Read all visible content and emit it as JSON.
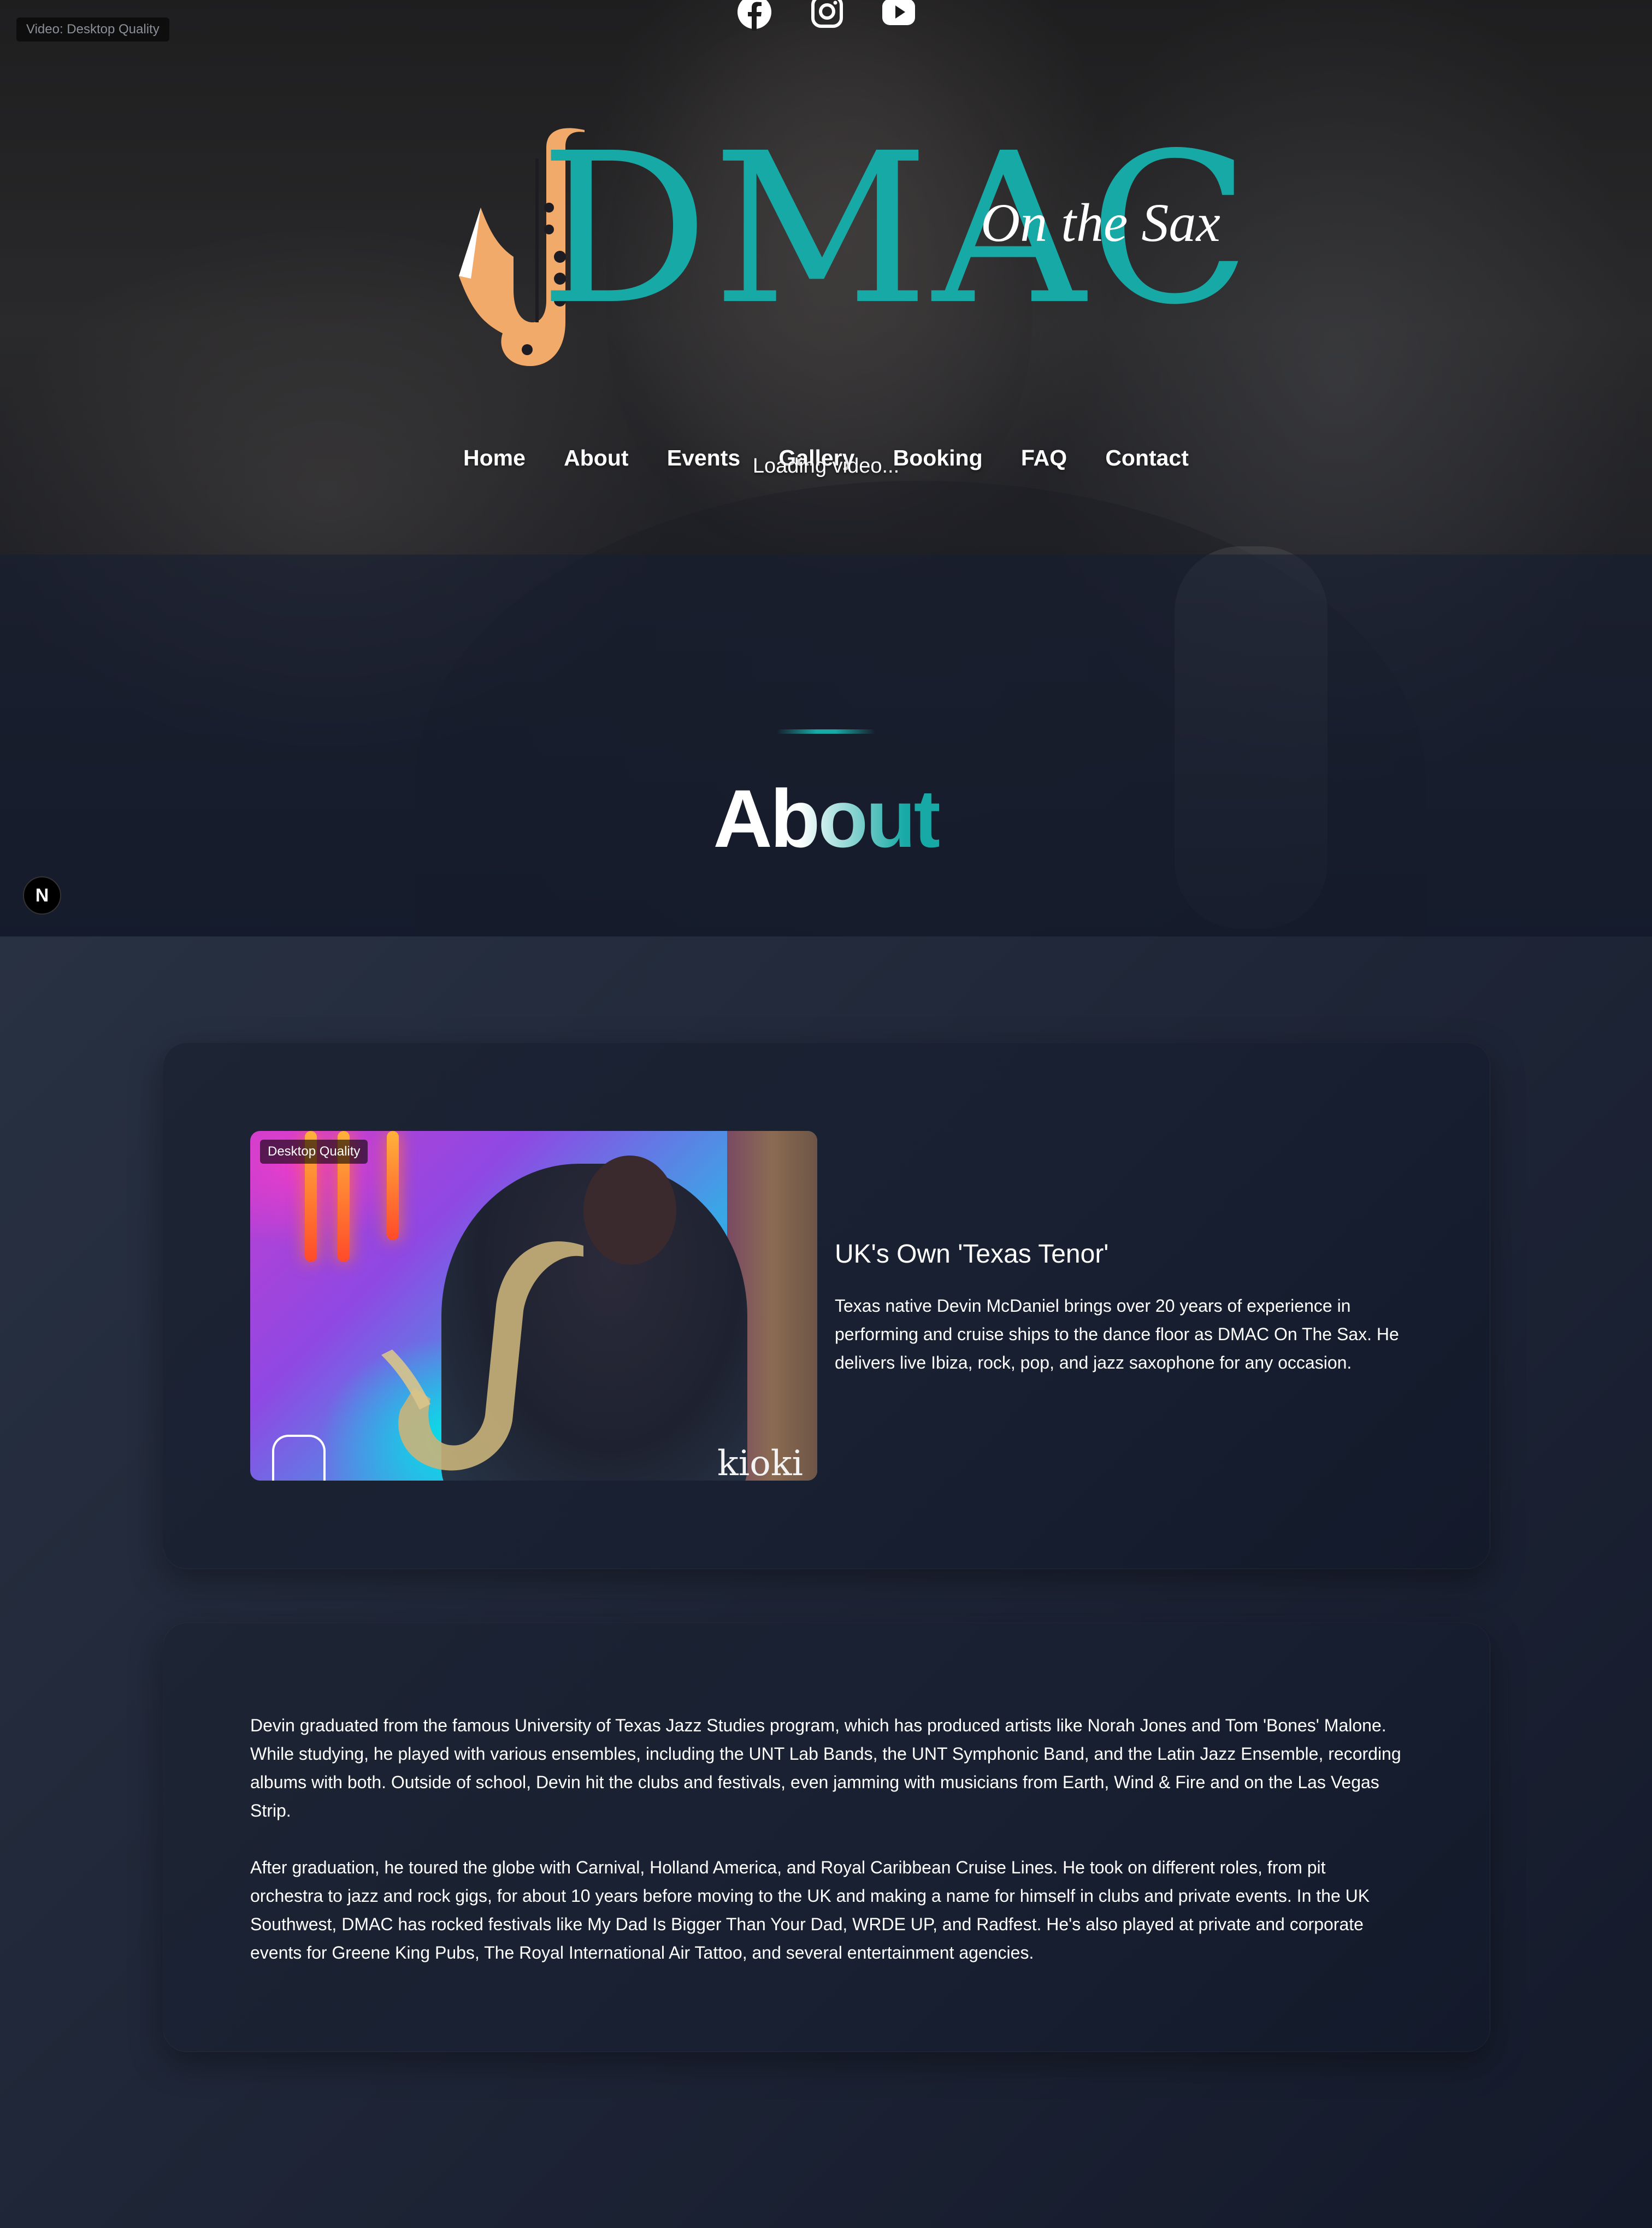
{
  "header": {
    "video_quality_label": "Video: Desktop Quality",
    "social": [
      {
        "icon": "facebook-icon"
      },
      {
        "icon": "instagram-icon"
      },
      {
        "icon": "youtube-icon"
      }
    ],
    "logo": {
      "wordmark": "DMAC",
      "tagline": "On the Sax",
      "colors": {
        "wordmark": "#17a9a5",
        "saxophone": "#f2aa6b"
      }
    },
    "nav": [
      "Home",
      "About",
      "Events",
      "Gallery",
      "Booking",
      "FAQ",
      "Contact"
    ],
    "loading_text": "Loading video..."
  },
  "about_section": {
    "heading": "About",
    "accent_color": "#17a9a5"
  },
  "dev_badge": "N",
  "intro_card": {
    "photo_badge": "Desktop Quality",
    "photo_watermark": "kioki",
    "title": "UK's Own 'Texas Tenor'",
    "text": "Texas native Devin McDaniel brings over 20 years of experience in performing and cruise ships to the dance floor as DMAC On The Sax. He delivers live Ibiza, rock, pop, and jazz saxophone for any occasion."
  },
  "bio_card": {
    "paragraphs": [
      "Devin graduated from the famous University of Texas Jazz Studies program, which has produced artists like Norah Jones and Tom 'Bones' Malone. While studying, he played with various ensembles, including the UNT Lab Bands, the UNT Symphonic Band, and the Latin Jazz Ensemble, recording albums with both. Outside of school, Devin hit the clubs and festivals, even jamming with musicians from Earth, Wind & Fire and on the Las Vegas Strip.",
      "After graduation, he toured the globe with Carnival, Holland America, and Royal Caribbean Cruise Lines. He took on different roles, from pit orchestra to jazz and rock gigs, for about 10 years before moving to the UK and making a name for himself in clubs and private events. In the UK Southwest, DMAC has rocked festivals like My Dad Is Bigger Than Your Dad, WRDE UP, and Radfest. He's also played at private and corporate events for Greene King Pubs, The Royal International Air Tattoo, and several entertainment agencies."
    ]
  }
}
